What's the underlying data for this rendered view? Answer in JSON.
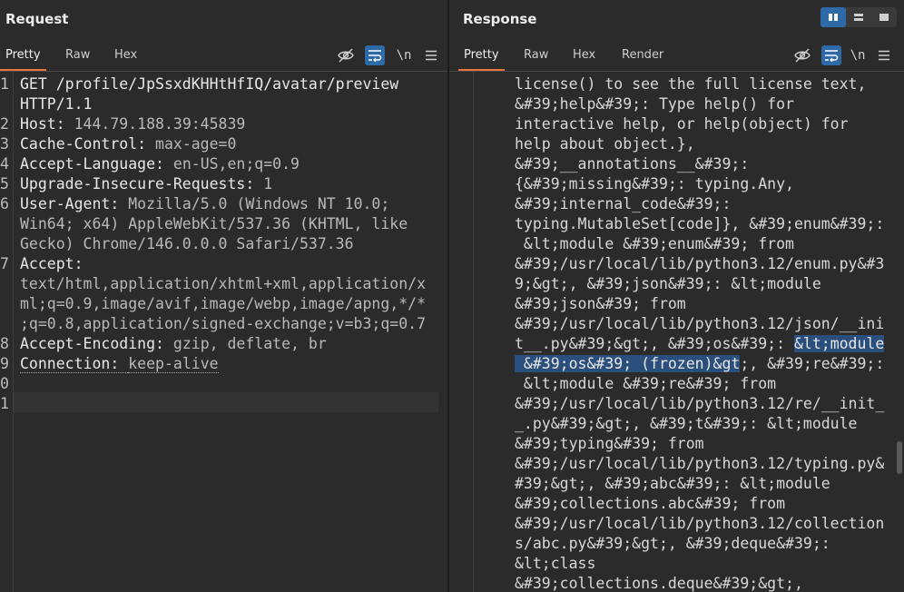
{
  "request": {
    "title": "Request",
    "tabs": [
      "Pretty",
      "Raw",
      "Hex"
    ],
    "lines": [
      {
        "n": "1",
        "parts": [
          {
            "t": "GET /profile/JpSsxdKHHtHfIQ/avatar/preview",
            "c": "hname"
          }
        ]
      },
      {
        "n": "",
        "parts": [
          {
            "t": "HTTP/1.1",
            "c": "hname"
          }
        ]
      },
      {
        "n": "2",
        "parts": [
          {
            "t": "Host: ",
            "c": "hname"
          },
          {
            "t": "144.79.188.39:45839",
            "c": "hval"
          }
        ]
      },
      {
        "n": "3",
        "parts": [
          {
            "t": "Cache-Control: ",
            "c": "hname"
          },
          {
            "t": "max-age=0",
            "c": "hval"
          }
        ]
      },
      {
        "n": "4",
        "parts": [
          {
            "t": "Accept-Language: ",
            "c": "hname"
          },
          {
            "t": "en-US,en;q=0.9",
            "c": "hval"
          }
        ]
      },
      {
        "n": "5",
        "parts": [
          {
            "t": "Upgrade-Insecure-Requests: ",
            "c": "hname"
          },
          {
            "t": "1",
            "c": "hval"
          }
        ]
      },
      {
        "n": "6",
        "parts": [
          {
            "t": "User-Agent: ",
            "c": "hname"
          },
          {
            "t": "Mozilla/5.0 (Windows NT 10.0;",
            "c": "hval"
          }
        ]
      },
      {
        "n": "",
        "parts": [
          {
            "t": "Win64; x64) AppleWebKit/537.36 (KHTML, like",
            "c": "hval"
          }
        ]
      },
      {
        "n": "",
        "parts": [
          {
            "t": "Gecko) Chrome/146.0.0.0 Safari/537.36",
            "c": "hval"
          }
        ]
      },
      {
        "n": "7",
        "parts": [
          {
            "t": "Accept: ",
            "c": "hname"
          }
        ]
      },
      {
        "n": "",
        "parts": [
          {
            "t": "text/html,application/xhtml+xml,application/x",
            "c": "hval"
          }
        ]
      },
      {
        "n": "",
        "parts": [
          {
            "t": "ml;q=0.9,image/avif,image/webp,image/apng,*/*",
            "c": "hval"
          }
        ]
      },
      {
        "n": "",
        "parts": [
          {
            "t": ";q=0.8,application/signed-exchange;v=b3;q=0.7",
            "c": "hval"
          }
        ]
      },
      {
        "n": "8",
        "parts": [
          {
            "t": "Accept-Encoding: ",
            "c": "hname"
          },
          {
            "t": "gzip, deflate, br",
            "c": "hval"
          }
        ]
      },
      {
        "n": "9",
        "parts": [
          {
            "t": "Connection: ",
            "c": "hname dot"
          },
          {
            "t": "keep-alive",
            "c": "hval dot"
          }
        ]
      },
      {
        "n": "0",
        "parts": []
      },
      {
        "n": "1",
        "parts": []
      }
    ]
  },
  "response": {
    "title": "Response",
    "tabs": [
      "Pretty",
      "Raw",
      "Hex",
      "Render"
    ],
    "lines": [
      [
        {
          "t": "license() to see the full license text,"
        }
      ],
      [
        {
          "t": "&#39;help&#39;: Type help() for"
        }
      ],
      [
        {
          "t": "interactive help, or help(object) for"
        }
      ],
      [
        {
          "t": "help about object.},"
        }
      ],
      [
        {
          "t": "&#39;__annotations__&#39;:"
        }
      ],
      [
        {
          "t": "{&#39;missing&#39;: typing.Any,"
        }
      ],
      [
        {
          "t": "&#39;internal_code&#39;:"
        }
      ],
      [
        {
          "t": "typing.MutableSet[code]}, &#39;enum&#39;:"
        }
      ],
      [
        {
          "t": " &lt;module &#39;enum&#39; from"
        }
      ],
      [
        {
          "t": "&#39;/usr/local/lib/python3.12/enum.py&#3"
        }
      ],
      [
        {
          "t": "9;&gt;, &#39;json&#39;: &lt;module"
        }
      ],
      [
        {
          "t": "&#39;json&#39; from"
        }
      ],
      [
        {
          "t": "&#39;/usr/local/lib/python3.12/json/__ini"
        }
      ],
      [
        {
          "t": "t__.py&#39;&gt;, &#39;os&#39;: "
        },
        {
          "t": "&lt;module",
          "s": true
        }
      ],
      [
        {
          "t": " &#39;os&#39; (frozen)&gt",
          "s": true
        },
        {
          "t": ";, &#39;re&#39;:"
        }
      ],
      [
        {
          "t": " &lt;module &#39;re&#39; from"
        }
      ],
      [
        {
          "t": "&#39;/usr/local/lib/python3.12/re/__init_"
        }
      ],
      [
        {
          "t": "_.py&#39;&gt;, &#39;t&#39;: &lt;module"
        }
      ],
      [
        {
          "t": "&#39;typing&#39; from"
        }
      ],
      [
        {
          "t": "&#39;/usr/local/lib/python3.12/typing.py&"
        }
      ],
      [
        {
          "t": "#39;&gt;, &#39;abc&#39;: &lt;module"
        }
      ],
      [
        {
          "t": "&#39;collections.abc&#39; from"
        }
      ],
      [
        {
          "t": "&#39;/usr/local/lib/python3.12/collection"
        }
      ],
      [
        {
          "t": "s/abc.py&#39;&gt;, &#39;deque&#39;:"
        }
      ],
      [
        {
          "t": "&lt;class"
        }
      ],
      [
        {
          "t": "&#39;collections.deque&#39;&gt;,"
        }
      ]
    ]
  },
  "icons": {
    "hide": "eye-slash-icon",
    "wrap": "wrap-icon",
    "newline": "\\n",
    "menu": "menu-icon"
  }
}
